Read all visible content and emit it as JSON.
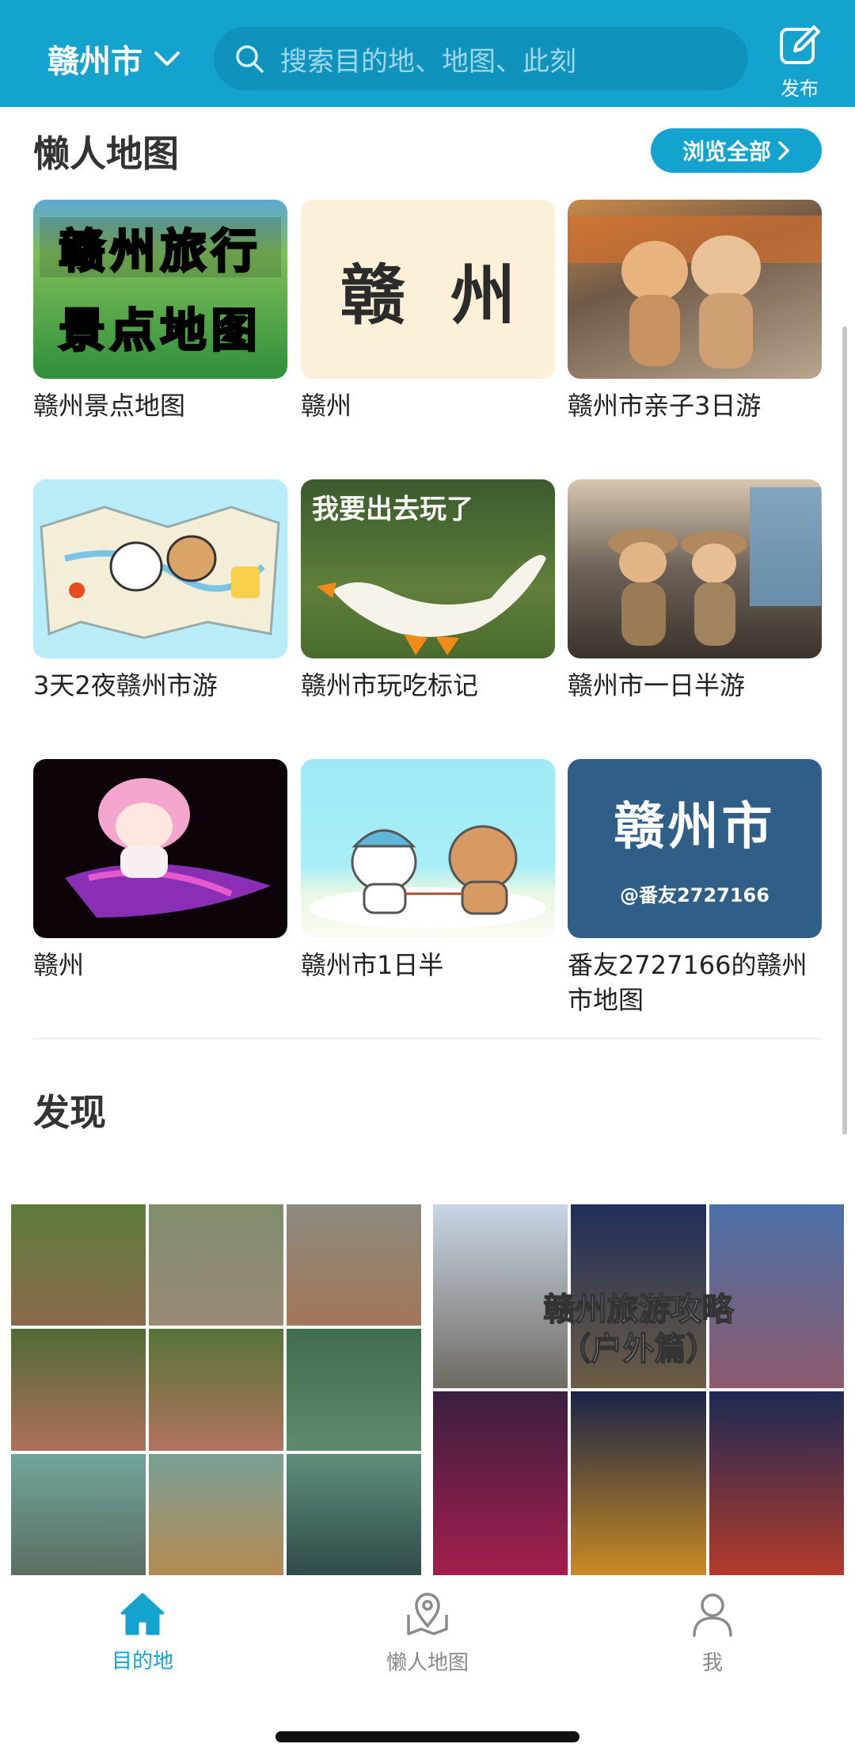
{
  "header": {
    "city": "赣州市",
    "search_placeholder": "搜索目的地、地图、此刻",
    "publish_label": "发布"
  },
  "lazy_maps": {
    "title": "懒人地图",
    "browse_all": "浏览全部",
    "cards": [
      {
        "title": "赣州景点地图",
        "image_text": [
          "赣州旅行",
          "景点地图"
        ]
      },
      {
        "title": "赣州",
        "image_text": [
          "赣  州"
        ]
      },
      {
        "title": "赣州市亲子3日游"
      },
      {
        "title": "3天2夜赣州市游"
      },
      {
        "title": "赣州市玩吃标记",
        "image_text": [
          "我要出去玩了"
        ]
      },
      {
        "title": "赣州市一日半游"
      },
      {
        "title": "赣州"
      },
      {
        "title": "赣州市1日半"
      },
      {
        "title": "番友2727166的赣州市地图",
        "image_text": [
          "赣州市",
          "@番友2727166"
        ]
      }
    ]
  },
  "discover": {
    "title": "发现",
    "cards": [
      {
        "image_text": []
      },
      {
        "image_text": [
          "赣州旅游攻略",
          "（户外篇）"
        ]
      }
    ]
  },
  "tabbar": {
    "tabs": [
      {
        "label": "目的地",
        "active": true,
        "icon": "home-icon"
      },
      {
        "label": "懒人地图",
        "active": false,
        "icon": "map-pin-icon"
      },
      {
        "label": "我",
        "active": false,
        "icon": "user-icon"
      }
    ]
  },
  "colors": {
    "brand": "#14a3cf",
    "tab_inactive": "#8a8a8a"
  }
}
